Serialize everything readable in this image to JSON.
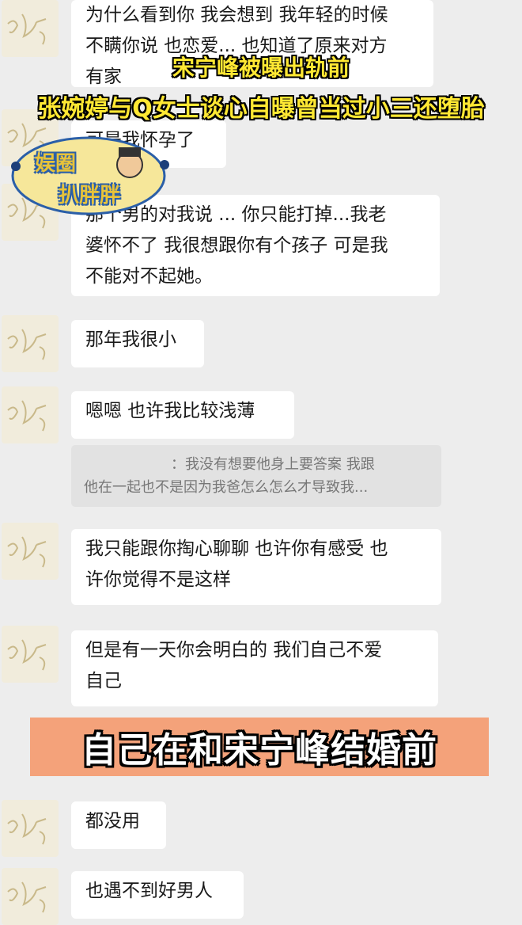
{
  "messages": [
    {
      "lines": [
        "为什么看到你 我会想到 我年轻的时候",
        "不瞒你说 也恋爱... 也知道了原来对方",
        "有家"
      ]
    },
    {
      "lines": [
        "可是我怀孕了"
      ]
    },
    {
      "lines": [
        "那个男的对我说 ... 你只能打掉...我老",
        "婆怀不了 我很想跟你有个孩子 可是我",
        "不能对不起她。"
      ]
    },
    {
      "lines": [
        "那年我很小"
      ]
    },
    {
      "lines": [
        "嗯嗯 也许我比较浅薄"
      ]
    },
    {
      "lines": [
        "我只能跟你掏心聊聊 也许你有感受 也",
        "许你觉得不是这样"
      ]
    },
    {
      "lines": [
        "但是有一天你会明白的 我们自己不爱",
        "自己"
      ]
    },
    {
      "lines": [
        "都没用"
      ]
    },
    {
      "lines": [
        "也遇不到好男人"
      ]
    }
  ],
  "quote": {
    "lines": [
      "：我没有想要他身上要答案 我跟",
      "他在一起也不是因为我爸怎么怎么才导致我..."
    ]
  },
  "overlay": {
    "headline_1": "宋宁峰被曝出轨前",
    "headline_2": "张婉婷与Q女士谈心自曝曾当过小三还堕胎",
    "banner": "自己在和宋宁峰结婚前",
    "logo_line_1": "娱圈",
    "logo_line_2": "扒胖胖"
  },
  "colors": {
    "background": "#ededed",
    "bubble": "#ffffff",
    "headline_yellow": "#ffe833",
    "banner_orange": "#f4a27a"
  }
}
